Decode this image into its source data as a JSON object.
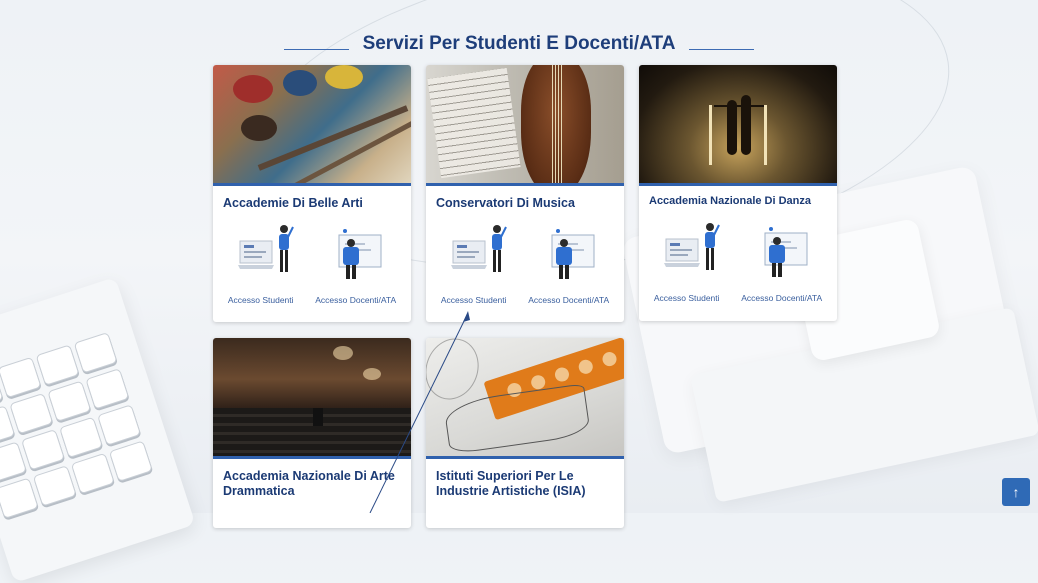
{
  "page": {
    "heading": "Servizi Per Studenti E Docenti/ATA",
    "colors": {
      "accent": "#3061ad",
      "title": "#1b3a74",
      "link": "#3a5f9e",
      "scroll_button": "#2f6ab6"
    }
  },
  "cards": [
    {
      "title": "Accademie Di Belle Arti",
      "photo": "paint-palette-photo",
      "link_students": "Accesso Studenti",
      "link_teachers": "Accesso Docenti/ATA"
    },
    {
      "title": "Conservatori Di Musica",
      "photo": "violin-photo",
      "link_students": "Accesso Studenti",
      "link_teachers": "Accesso Docenti/ATA"
    },
    {
      "title": "Accademia Nazionale Di Danza",
      "photo": "dancers-photo",
      "link_students": "Accesso Studenti",
      "link_teachers": "Accesso Docenti/ATA"
    },
    {
      "title": "Accademia Nazionale Di Arte Drammatica",
      "photo": "theatre-photo"
    },
    {
      "title": "Istituti Superiori Per Le Industrie Artistiche (ISIA)",
      "photo": "design-sketch-photo"
    }
  ],
  "scroll_top": {
    "icon": "arrow-up-icon",
    "glyph": "↑"
  }
}
